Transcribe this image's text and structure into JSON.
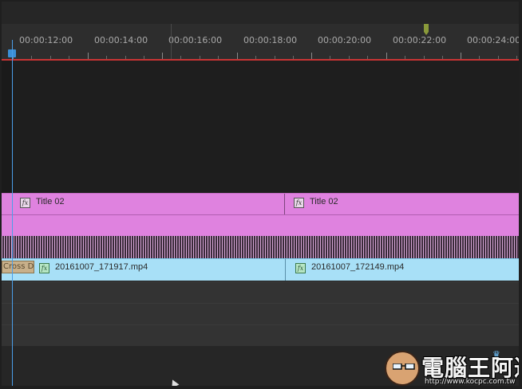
{
  "timeline": {
    "timecodes": [
      "00:00:12:00",
      "00:00:14:00",
      "00:00:16:00",
      "00:00:18:00",
      "00:00:20:00",
      "00:00:22:00",
      "00:00:24:00"
    ]
  },
  "tracks": {
    "title_track": {
      "clips": [
        {
          "fx": "fx",
          "label": "Title 02"
        },
        {
          "fx": "fx",
          "label": "Title 02"
        }
      ]
    },
    "video_track": {
      "transition": "Cross D",
      "clips": [
        {
          "fx": "fx",
          "label": "20161007_171917.mp4"
        },
        {
          "fx": "fx",
          "label": "20161007_172149.mp4"
        }
      ]
    }
  },
  "colors": {
    "title_clip": "#df82df",
    "video_clip": "#a8e0f7",
    "playhead": "#4b9ee8",
    "ruler_line": "#c93434"
  },
  "watermark": {
    "text": "電腦王阿達",
    "url": "http://www.kocpc.com.tw"
  }
}
